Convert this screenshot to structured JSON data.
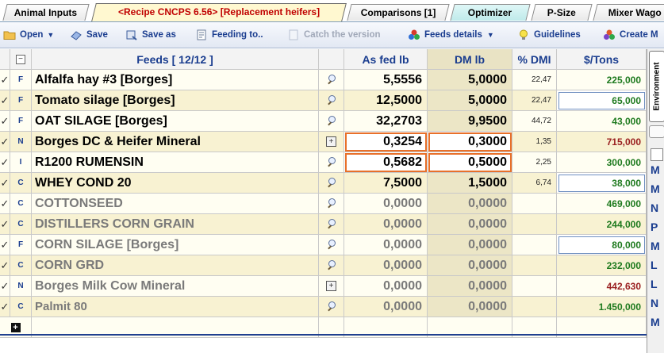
{
  "tabs": [
    {
      "label": "Animal Inputs"
    },
    {
      "label": "<Recipe CNCPS 6.56> [Replacement heifers]"
    },
    {
      "label": "Comparisons [1]"
    },
    {
      "label": "Optimizer"
    },
    {
      "label": "P-Size"
    },
    {
      "label": "Mixer Wago"
    }
  ],
  "toolbar": {
    "open": "Open",
    "save": "Save",
    "save_as": "Save as",
    "feeding_to": "Feeding to..",
    "catch_version": "Catch the version",
    "feeds_details": "Feeds details",
    "guidelines": "Guidelines",
    "create": "Create M"
  },
  "grid": {
    "headers": {
      "feeds": "Feeds   [ 12/12 ]",
      "as_fed": "As fed lb",
      "dm": "DM lb",
      "pdmi": "% DMI",
      "price": "$/Tons"
    },
    "rows": [
      {
        "check": "✓",
        "type": "F",
        "name": "Alfalfa hay #3 [Borges]",
        "icon": "lens",
        "as_fed": "5,5556",
        "dm": "5,0000",
        "pdmi": "22,47",
        "price": "225,000"
      },
      {
        "check": "✓",
        "type": "F",
        "name": "Tomato silage [Borges]",
        "icon": "lens",
        "as_fed": "12,5000",
        "dm": "5,0000",
        "pdmi": "22,47",
        "price": "65,000"
      },
      {
        "check": "✓",
        "type": "F",
        "name": "OAT SILAGE [Borges]",
        "icon": "lens",
        "as_fed": "32,2703",
        "dm": "9,9500",
        "pdmi": "44,72",
        "price": "43,000"
      },
      {
        "check": "✓",
        "type": "N",
        "name": "Borges DC & Heifer Mineral",
        "icon": "mix",
        "as_fed": "0,3254",
        "dm": "0,3000",
        "pdmi": "1,35",
        "price": "715,000"
      },
      {
        "check": "✓",
        "type": "I",
        "name": "R1200 RUMENSIN",
        "icon": "lens",
        "as_fed": "0,5682",
        "dm": "0,5000",
        "pdmi": "2,25",
        "price": "300,000"
      },
      {
        "check": "✓",
        "type": "C",
        "name": "WHEY COND 20",
        "icon": "lens",
        "as_fed": "7,5000",
        "dm": "1,5000",
        "pdmi": "6,74",
        "price": "38,000"
      },
      {
        "check": "✓",
        "type": "C",
        "name": "COTTONSEED",
        "icon": "lens",
        "as_fed": "0,0000",
        "dm": "0,0000",
        "pdmi": "",
        "price": "469,000"
      },
      {
        "check": "✓",
        "type": "C",
        "name": "DISTILLERS CORN  GRAIN",
        "icon": "lens",
        "as_fed": "0,0000",
        "dm": "0,0000",
        "pdmi": "",
        "price": "244,000"
      },
      {
        "check": "✓",
        "type": "F",
        "name": "CORN SILAGE [Borges]",
        "icon": "lens",
        "as_fed": "0,0000",
        "dm": "0,0000",
        "pdmi": "",
        "price": "80,000"
      },
      {
        "check": "✓",
        "type": "C",
        "name": "CORN GRD",
        "icon": "lens",
        "as_fed": "0,0000",
        "dm": "0,0000",
        "pdmi": "",
        "price": "232,000"
      },
      {
        "check": "✓",
        "type": "N",
        "name": "Borges Milk Cow Mineral",
        "icon": "mix",
        "as_fed": "0,0000",
        "dm": "0,0000",
        "pdmi": "",
        "price": "442,630"
      },
      {
        "check": "✓",
        "type": "C",
        "name": "Palmit 80",
        "icon": "lens",
        "as_fed": "0,0000",
        "dm": "0,0000",
        "pdmi": "",
        "price": "1.450,000"
      }
    ]
  },
  "right_panel": {
    "tab_label": "Environment",
    "items": [
      "M",
      "M",
      "N",
      "P",
      "M",
      "L",
      "L",
      "N",
      "M"
    ]
  },
  "colors": {
    "accent_blue": "#1a3d8f",
    "price_green": "#1e7a1e",
    "highlight_orange": "#e8702a",
    "active_tab_red": "#c00000",
    "dm_column": "#ece6c6"
  }
}
